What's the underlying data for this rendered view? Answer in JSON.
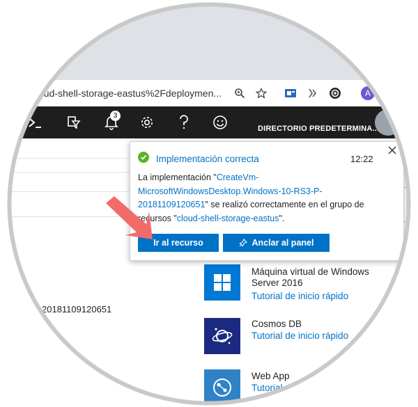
{
  "browser": {
    "url_text": "oud-shell-storage-eastus%2Fdeploymen...",
    "avatar_letter": "A",
    "icons": [
      "zoom-icon",
      "star-icon",
      "extension-icon",
      "extension-icon",
      "extension-icon"
    ]
  },
  "azure_bar": {
    "icons": [
      "cloud-shell-icon",
      "directory-filter-icon",
      "bell-icon",
      "gear-icon",
      "help-icon",
      "feedback-smiley-icon"
    ],
    "notification_count": "3",
    "directory_label": "DIRECTORIO PREDETERMINA..."
  },
  "page": {
    "left_id": "20181109120651"
  },
  "notification": {
    "title": "Implementación correcta",
    "time": "12:22",
    "body_prefix": "La implementación \"",
    "deployment_name": "CreateVm-MicrosoftWindowsDesktop.Windows-10-RS3-P-20181109120651",
    "body_middle": "\" se realizó correctamente en el grupo de recursos \"",
    "resource_group": "cloud-shell-storage-eastus",
    "body_suffix": "\".",
    "go_button": "Ir al recurso",
    "pin_button": "Anclar al panel"
  },
  "services": [
    {
      "title": "Máquina virtual de Windows Server 2016",
      "link": "Tutorial de inicio rápido",
      "icon": "windows-icon",
      "color": "#0078d4"
    },
    {
      "title": "Cosmos DB",
      "link": "Tutorial de inicio rápido",
      "icon": "cosmos-db-icon",
      "color": "#1b2a80"
    },
    {
      "title": "Web App",
      "link": "Tutorial de inicio rápido",
      "icon": "web-app-icon",
      "color": "#2f82c6"
    }
  ],
  "colors": {
    "accent": "#0072c6",
    "topbar": "#1e1e1e",
    "success": "#5bb324",
    "arrow": "#f26b6b"
  }
}
